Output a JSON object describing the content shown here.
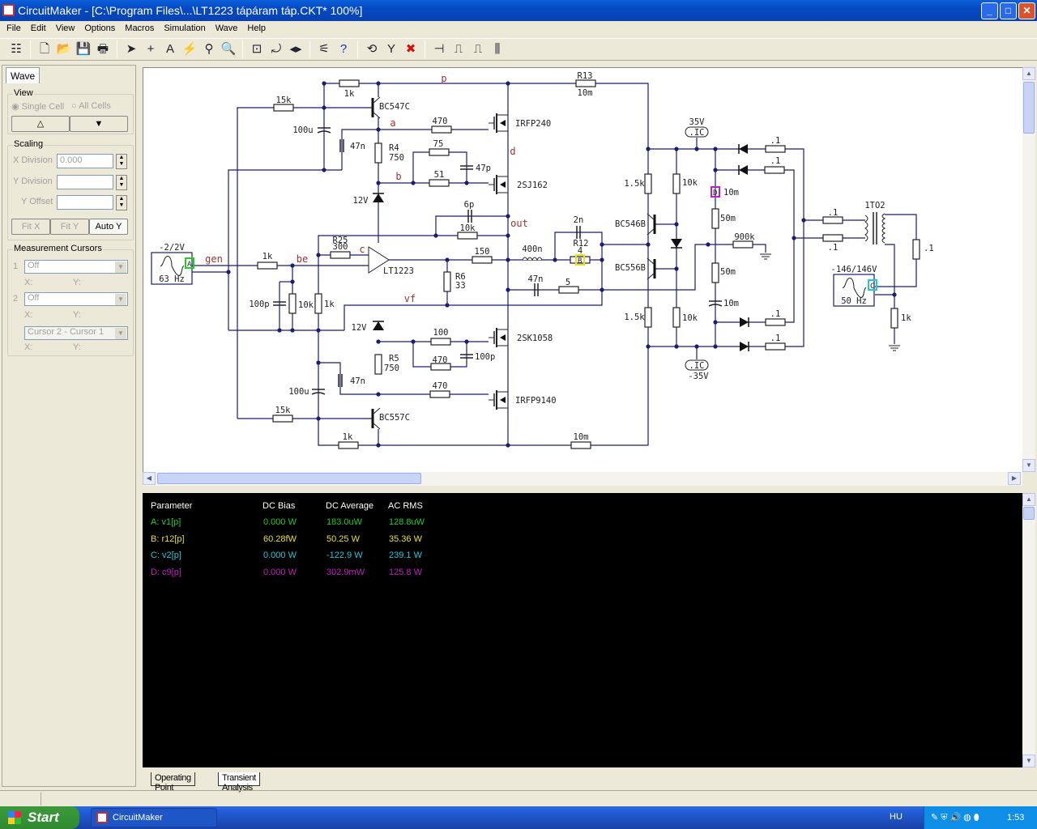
{
  "window": {
    "title": "CircuitMaker - [C:\\Program Files\\...\\LT1223 tápáram táp.CKT* 100%]",
    "minimize": "_",
    "maximize": "□",
    "close": "✕"
  },
  "menu": [
    "File",
    "Edit",
    "View",
    "Options",
    "Macros",
    "Simulation",
    "Wave",
    "Help"
  ],
  "toolbar": {
    "buttons": [
      {
        "icon": "toggle-panel-icon",
        "glyph": "☷"
      },
      {
        "sep": true
      },
      {
        "icon": "new-file-icon",
        "glyph": "🗋"
      },
      {
        "icon": "open-folder-icon",
        "glyph": "📂"
      },
      {
        "icon": "save-icon",
        "glyph": "💾"
      },
      {
        "icon": "print-icon",
        "glyph": "🖶"
      },
      {
        "sep": true
      },
      {
        "icon": "arrow-pointer-icon",
        "glyph": "➤"
      },
      {
        "icon": "wire-cross-icon",
        "glyph": "+"
      },
      {
        "icon": "text-icon",
        "glyph": "A"
      },
      {
        "icon": "fault-lightning-icon",
        "glyph": "⚡"
      },
      {
        "icon": "probe-icon",
        "glyph": "⚲"
      },
      {
        "icon": "zoom-icon",
        "glyph": "🔍"
      },
      {
        "sep": true
      },
      {
        "icon": "zoom-fit-icon",
        "glyph": "⊡"
      },
      {
        "icon": "rotate-icon",
        "glyph": "⤾"
      },
      {
        "icon": "mirror-icon",
        "glyph": "◂▸"
      },
      {
        "sep": true
      },
      {
        "icon": "digital-analog-icon",
        "glyph": "⚟"
      },
      {
        "icon": "help-icon",
        "glyph": "?"
      },
      {
        "sep": true
      },
      {
        "icon": "reset-icon",
        "glyph": "⟲"
      },
      {
        "icon": "run-icon",
        "glyph": "Y"
      },
      {
        "icon": "stop-icon",
        "glyph": "✖"
      },
      {
        "sep": true
      },
      {
        "icon": "schematic-icon",
        "glyph": "⊣"
      },
      {
        "icon": "waveform-icon",
        "glyph": "⎍"
      },
      {
        "icon": "split-view-icon",
        "glyph": "⎍"
      },
      {
        "icon": "analysis-icon",
        "glyph": "⫼"
      }
    ]
  },
  "panel": {
    "tab": "Wave",
    "view": {
      "title": "View",
      "single_cell": "Single Cell",
      "all_cells": "All Cells",
      "up": "△",
      "down": "▼"
    },
    "scaling": {
      "title": "Scaling",
      "x_division_label": "X Division",
      "x_division_value": "0.000",
      "y_division_label": "Y Division",
      "y_division_value": "",
      "y_offset_label": "Y Offset",
      "y_offset_value": "",
      "fit_x": "Fit X",
      "fit_y": "Fit Y",
      "auto_y": "Auto Y"
    },
    "cursors": {
      "title": "Measurement Cursors",
      "c1_num": "1",
      "c1_value": "Off",
      "c2_num": "2",
      "c2_value": "Off",
      "diff_value": "Cursor 2 - Cursor 1",
      "x": "X:",
      "y": "Y:"
    }
  },
  "schematic": {
    "labels": {
      "p": "p",
      "a": "a",
      "b": "b",
      "d": "d",
      "out": "out",
      "c": "c",
      "gen": "gen",
      "be": "be",
      "vf": "vf",
      "r1k_top": "1k",
      "r13": "R13",
      "r13_val": "10m",
      "r15k_top": "15k",
      "c100u_top": "100u",
      "q1": "BC547C",
      "r470_a": "470",
      "c47n_top": "47n",
      "r4": "R4",
      "r4_val": "750",
      "r75": "75",
      "c47p": "47p",
      "r51": "51",
      "m1": "IRFP240",
      "m2": "2SJ162",
      "z1": "12V",
      "c6p": "6p",
      "r10k_fb": "10k",
      "r25": "R25",
      "r25_val": "300",
      "u1": "LT1223",
      "r1k_in": "1k",
      "r150": "150",
      "l400n": "400n",
      "c2n": "2n",
      "r12": "R12",
      "r12_val": "4",
      "r6": "R6",
      "r6_val": "33",
      "c47n_out": "47n",
      "r5ohm": "5",
      "src1_amp": "-2/2V",
      "src1_freq": "63 Hz",
      "c100p_in": "100p",
      "r10k_in": "10k",
      "r1k_in2": "1k",
      "z2": "12V",
      "r100": "100",
      "r470_b": "470",
      "c100p_b": "100p",
      "m3": "2SK1058",
      "r5": "R5",
      "r5_val": "750",
      "c47n_bot": "47n",
      "c100u_bot": "100u",
      "r470_c": "470",
      "m4": "IRFP9140",
      "r15k_bot": "15k",
      "q2": "BC557C",
      "r1k_bot": "1k",
      "r10m_bot": "10m",
      "ic_pos_v": "35V",
      "ic_pos": ".IC",
      "ic_neg": ".IC",
      "ic_neg_v": "-35V",
      "r1_5k_top": "1.5k",
      "r10k_top": "10k",
      "c10m_top": "10m",
      "r50m_top": "50m",
      "q3": "BC546B",
      "q4": "BC556B",
      "r900k": "900k",
      "r50m_bot": "50m",
      "c10m_bot": "10m",
      "r1_5k_bot": "1.5k",
      "r10k_bot": "10k",
      "rd1": ".1",
      "rd2": ".1",
      "rd3": ".1",
      "rd4": ".1",
      "rt1": ".1",
      "rt2": ".1",
      "tx": "1TO2",
      "rsec": ".1",
      "src2_amp": "-146/146V",
      "src2_freq": "50 Hz",
      "r1k_gnd": "1k"
    },
    "probes": {
      "A": "A",
      "B": "B",
      "C": "C",
      "D": "D"
    },
    "colors": {
      "wire": "#1c1c70",
      "node_label": "#a03030",
      "probe_A": "#22cc22",
      "probe_B": "#e8e020",
      "probe_C": "#20c8d8",
      "probe_D": "#c020c0"
    }
  },
  "results": {
    "headers": [
      "Parameter",
      "DC Bias",
      "DC Average",
      "AC RMS"
    ],
    "rows": [
      {
        "param": "A: v1[p]",
        "dc_bias": "0.000 W",
        "dc_avg": "183.0uW",
        "ac_rms": "128.8uW",
        "color": "#22cc22"
      },
      {
        "param": "B: r12[p]",
        "dc_bias": "60.28fW",
        "dc_avg": "50.25 W",
        "ac_rms": "35.36 W",
        "color": "#e8e020"
      },
      {
        "param": "C: v2[p]",
        "dc_bias": "0.000 W",
        "dc_avg": "-122.9 W",
        "ac_rms": "239.1 W",
        "color": "#20c8d8"
      },
      {
        "param": "D: c9[p]",
        "dc_bias": "0.000 W",
        "dc_avg": "302.9mW",
        "ac_rms": "125.8 W",
        "color": "#c020c0"
      }
    ]
  },
  "bottom_tabs": [
    "Operating Point",
    "Transient Analysis"
  ],
  "taskbar": {
    "start": "Start",
    "app": "CircuitMaker",
    "lang": "HU",
    "time": "1:53"
  }
}
